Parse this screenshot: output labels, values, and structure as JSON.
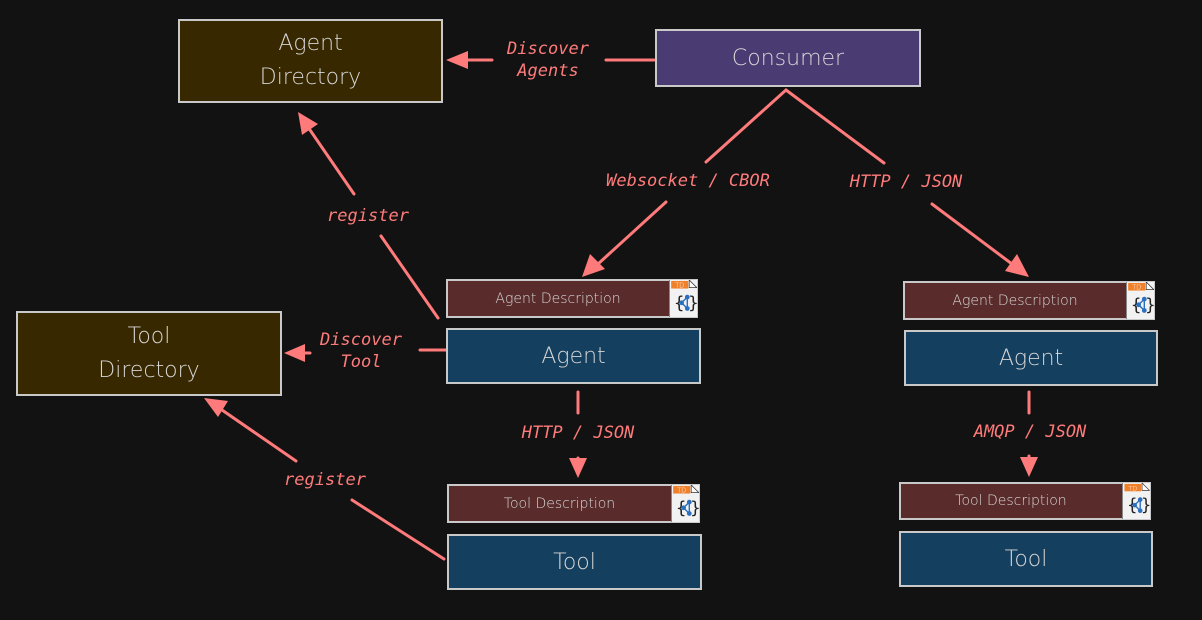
{
  "nodes": {
    "agent_directory": "Agent\nDirectory",
    "tool_directory": "Tool\nDirectory",
    "consumer": "Consumer",
    "agent_left": "Agent",
    "agent_right": "Agent",
    "tool_left": "Tool",
    "tool_right": "Tool",
    "agent_desc_left": "Agent Description",
    "agent_desc_right": "Agent Description",
    "tool_desc_left": "Tool Description",
    "tool_desc_right": "Tool Description"
  },
  "edge_labels": {
    "discover_agents": "Discover\nAgents",
    "discover_tool": "Discover\nTool",
    "register_agent": "register",
    "register_tool": "register",
    "websocket_cbor": "Websocket / CBOR",
    "http_json_consumer": "HTTP / JSON",
    "http_json_tool": "HTTP / JSON",
    "amqp_json": "AMQP / JSON"
  },
  "icons": {
    "td_badge": "TD",
    "td_symbol": "thing-description-icon"
  },
  "colors": {
    "background": "#121212",
    "edge": "#ff7b7b",
    "directory_fill": "#382800",
    "consumer_fill": "#4a3b72",
    "agent_fill": "#153f5f",
    "description_fill": "#5a2b2b",
    "td_badge": "#f0802a",
    "td_graph": "#2a6fc0"
  }
}
